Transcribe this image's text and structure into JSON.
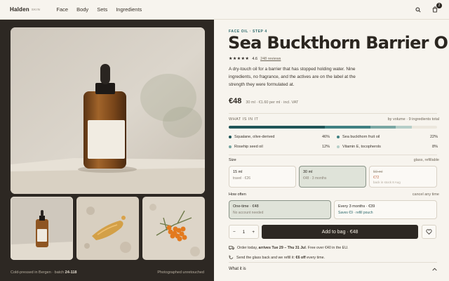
{
  "header": {
    "brand": "Halden",
    "brand_sub": "SKIN",
    "nav": [
      "Face",
      "Body",
      "Sets",
      "Ingredients"
    ],
    "cart_count": "2"
  },
  "gallery": {
    "caption_left_prefix": "Cold-pressed in Bergen · batch ",
    "caption_left_batch": "24-118",
    "caption_right": "Photographed unretouched"
  },
  "product": {
    "eyebrow": "FACE OIL · STEP 4",
    "title": "Sea Buckthorn Barrier Oil",
    "stars": "★★★★★",
    "rating": "4.6",
    "reviews": "248 reviews",
    "description": "A dry-touch oil for a barrier that has stopped holding water. Nine ingredients, no fragrance, and the actives are on the label at the strength they were formulated at.",
    "price": "€48",
    "price_unit": "30 ml · €1.60 per ml · incl. VAT"
  },
  "ingredients": {
    "label": "WHAT IS IN IT",
    "meta": "by volume · 9 ingredients total",
    "items": [
      {
        "name": "Squalane, olive-derived",
        "pct": "46%",
        "color": "#1f5558"
      },
      {
        "name": "Sea buckthorn fruit oil",
        "pct": "22%",
        "color": "#3f8082"
      },
      {
        "name": "Rosehip seed oil",
        "pct": "12%",
        "color": "#79a7a3"
      },
      {
        "name": "Vitamin E, tocopherols",
        "pct": "8%",
        "color": "#b5cec8"
      }
    ],
    "shares": [
      46,
      22,
      12,
      8,
      12
    ]
  },
  "size": {
    "label": "Size",
    "meta": "glass, refillable",
    "options": [
      {
        "a": "15 ml",
        "b": "travel · €26"
      },
      {
        "a": "30 ml",
        "b": "€48 · 3 months"
      },
      {
        "a": "50 ml",
        "b1": "€72",
        "b2": "back in stock 8 Aug"
      }
    ]
  },
  "frequency": {
    "label": "How often",
    "meta": "cancel any time",
    "options": [
      {
        "a": "One-time · €48",
        "b": "No account needed"
      },
      {
        "a": "Every 3 months · €39",
        "b": "Saves €9 · refill pouch"
      }
    ]
  },
  "cart": {
    "minus": "−",
    "qty": "1",
    "plus": "+",
    "add_label": "Add to bag · €48"
  },
  "shipping": {
    "prefix": "Order today, ",
    "dates": "arrives Tue 29 – Thu 31 Jul",
    "suffix": ". Free over €40 in the EU."
  },
  "refill": {
    "prefix": "Send the glass back and we refill it: ",
    "bold": "€6 off",
    "suffix": " every time."
  },
  "accordion": {
    "label": "What it is"
  }
}
